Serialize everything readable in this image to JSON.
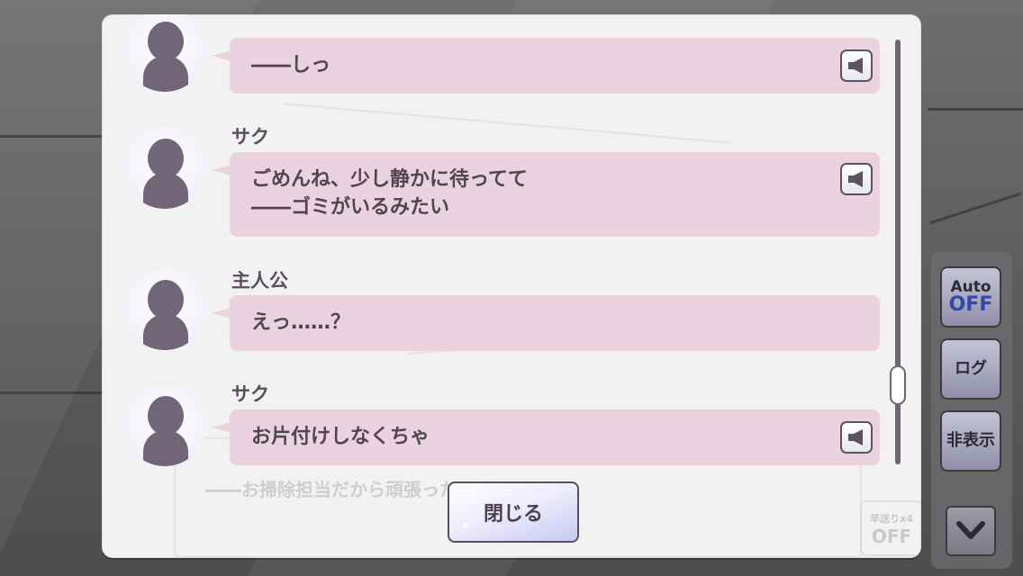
{
  "log_entries": [
    {
      "speaker": "",
      "lines": [
        "――しっ"
      ],
      "voice_icon": "speaker-icon",
      "has_voice": true
    },
    {
      "speaker": "サク",
      "lines": [
        "ごめんね、少し静かに待ってて",
        "――ゴミがいるみたい"
      ],
      "voice_icon": "speaker-icon",
      "has_voice": true
    },
    {
      "speaker": "主人公",
      "lines": [
        "えっ……？"
      ],
      "has_voice": false
    },
    {
      "speaker": "サク",
      "lines": [
        "お片付けしなくちゃ"
      ],
      "voice_icon": "speaker-icon",
      "has_voice": true
    }
  ],
  "close_button": {
    "label": "閉じる"
  },
  "side_menu": {
    "auto": {
      "label_top": "Auto",
      "label_state": "OFF"
    },
    "log": {
      "label": "ログ"
    },
    "hide": {
      "label": "非表示"
    },
    "collapse_icon": "chevron-down-icon"
  },
  "background_dialog": {
    "text": "――お掃除担当だから頑張ったなきゃ",
    "fast_forward_label": "早送りx4",
    "fast_forward_state": "OFF"
  },
  "scroll": {
    "position_fraction": 0.78
  },
  "colors": {
    "panel_bg": "#f2f2f2",
    "bubble_bg": "#ead3de",
    "text": "#4f4553",
    "button_accent": "#c9c9f2",
    "off_blue": "#2f4aa8"
  }
}
